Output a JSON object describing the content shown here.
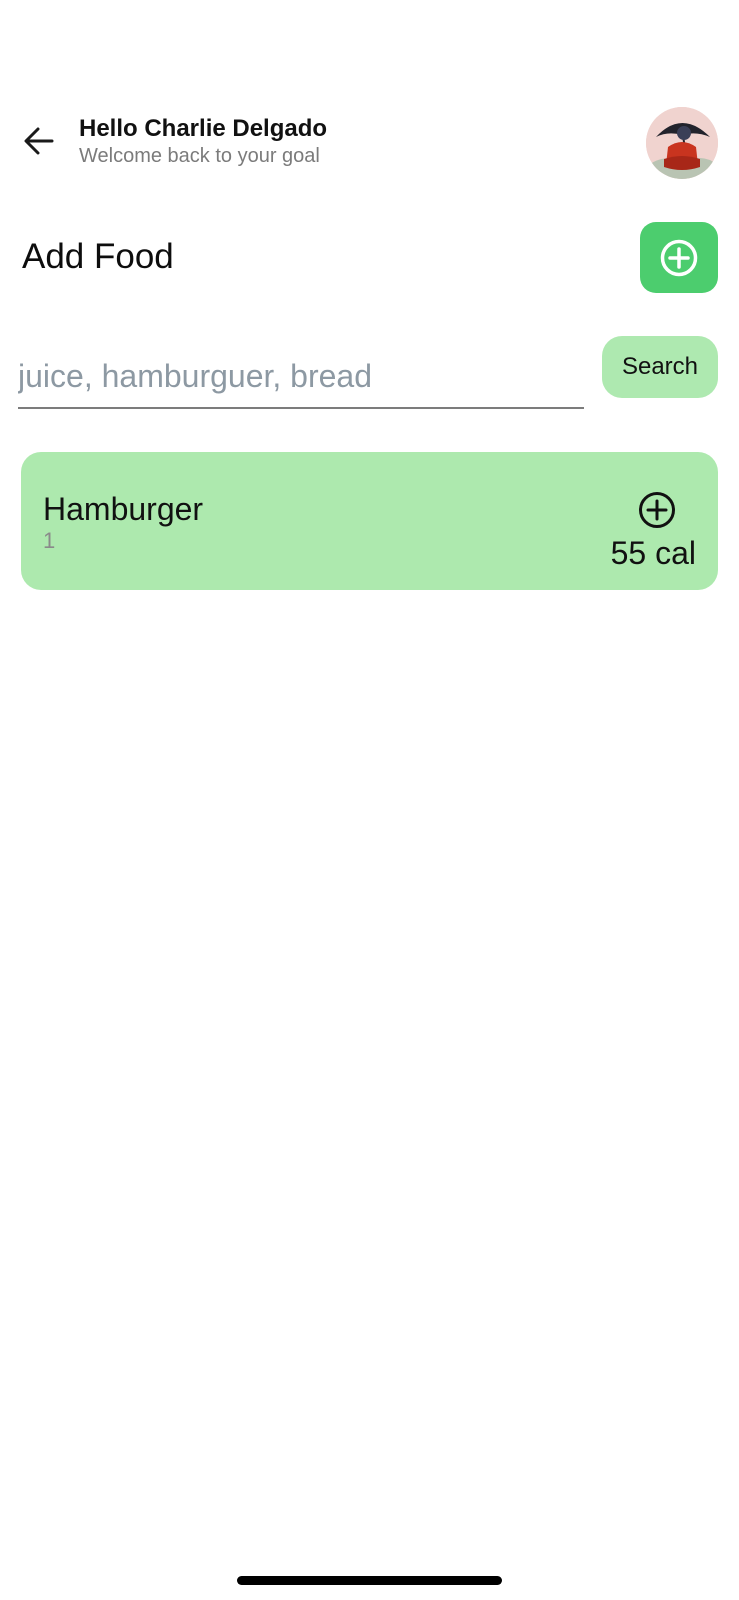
{
  "header": {
    "back_icon": "arrow-left-icon",
    "title": "Hello Charlie Delgado",
    "subtitle": "Welcome back to your goal",
    "avatar": "user-avatar"
  },
  "add_food": {
    "title": "Add Food",
    "add_icon": "plus-circle-icon",
    "accent_color": "#4ccd6e"
  },
  "search": {
    "placeholder": "juice, hamburguer, bread",
    "value": "",
    "button_label": "Search",
    "button_color": "#aee9b0"
  },
  "foods": [
    {
      "name": "Hamburger",
      "quantity": "1",
      "calories": "55 cal",
      "add_icon": "plus-circle-icon",
      "card_color": "#ade9ae"
    }
  ]
}
